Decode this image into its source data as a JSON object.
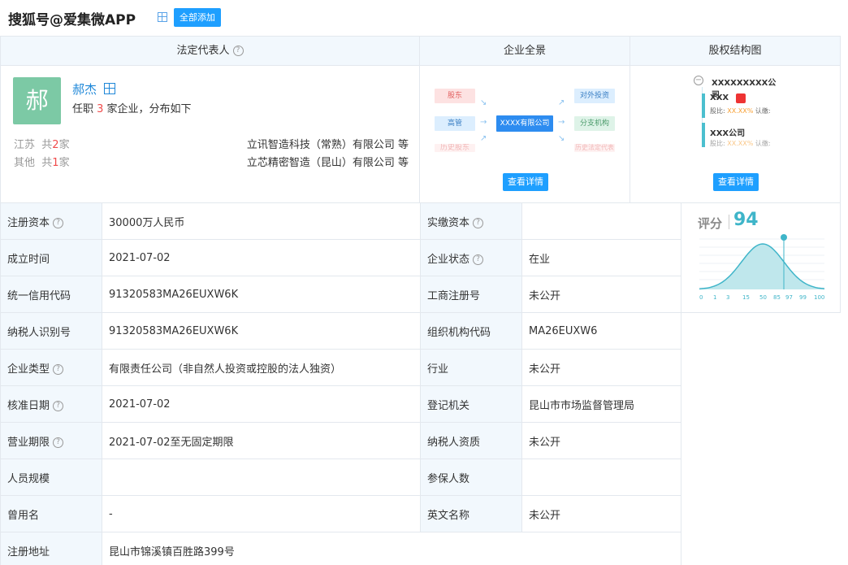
{
  "topbar": {
    "watermark": "搜狐号@爱集微APP",
    "add_all_button": "全部添加"
  },
  "panels": {
    "legal": {
      "title": "法定代表人",
      "person": {
        "avatar_char": "郝",
        "name": "郝杰",
        "desc_prefix": "任职 ",
        "count": "3",
        "desc_suffix": " 家企业，分布如下"
      },
      "regions": [
        {
          "region": "江苏",
          "prefix": "共",
          "count": "2",
          "suffix": "家",
          "company": "立讯智造科技（常熟）有限公司 等"
        },
        {
          "region": "其他",
          "prefix": "共",
          "count": "1",
          "suffix": "家",
          "company": "立芯精密智造（昆山）有限公司 等"
        }
      ]
    },
    "overview": {
      "title": "企业全景",
      "boxes": {
        "shareholder": "股东",
        "executive": "高管",
        "history": "历史股东",
        "center": "XXXX有限公司",
        "investment": "对外投资",
        "branch": "分支机构",
        "history_legal": "历史法定代表人"
      },
      "detail_button": "查看详情"
    },
    "equity": {
      "title": "股权结构图",
      "company": "XXXXXXXXX公司",
      "node1_name": "XXX",
      "node1_ratio_label": "股比:",
      "node1_ratio": "XX.XX%",
      "node1_sub": "认缴:",
      "node2_name": "XXX公司",
      "node2_ratio_label": "股比:",
      "node2_ratio": "XX.XX%",
      "node2_sub": "认缴:",
      "detail_button": "查看详情"
    }
  },
  "score": {
    "label": "评分",
    "value": "94",
    "axis_ticks": [
      "0",
      "1",
      "3",
      "15",
      "50",
      "85",
      "97",
      "99",
      "100"
    ],
    "accent": "#3fb5c9"
  },
  "info_rows": [
    {
      "l1": "注册资本",
      "h1": true,
      "v1": "30000万人民币",
      "l2": "实缴资本",
      "h2": true,
      "v2": ""
    },
    {
      "l1": "成立时间",
      "h1": false,
      "v1": "2021-07-02",
      "l2": "企业状态",
      "h2": true,
      "v2": "在业"
    },
    {
      "l1": "统一信用代码",
      "h1": false,
      "v1": "91320583MA26EUXW6K",
      "l2": "工商注册号",
      "h2": false,
      "v2": "未公开"
    },
    {
      "l1": "纳税人识别号",
      "h1": false,
      "v1": "91320583MA26EUXW6K",
      "l2": "组织机构代码",
      "h2": false,
      "v2": "MA26EUXW6"
    },
    {
      "l1": "企业类型",
      "h1": true,
      "v1": "有限责任公司（非自然人投资或控股的法人独资）",
      "l2": "行业",
      "h2": false,
      "v2": "未公开"
    },
    {
      "l1": "核准日期",
      "h1": true,
      "v1": "2021-07-02",
      "l2": "登记机关",
      "h2": false,
      "v2": "昆山市市场监督管理局"
    },
    {
      "l1": "营业期限",
      "h1": true,
      "v1": "2021-07-02至无固定期限",
      "l2": "纳税人资质",
      "h2": false,
      "v2": "未公开"
    },
    {
      "l1": "人员规模",
      "h1": false,
      "v1": "",
      "l2": "参保人数",
      "h2": false,
      "v2": ""
    },
    {
      "l1": "曾用名",
      "h1": false,
      "v1": "-",
      "l2": "英文名称",
      "h2": false,
      "v2": "未公开"
    },
    {
      "l1": "注册地址",
      "h1": false,
      "v1": "昆山市锦溪镇百胜路399号",
      "l2": "",
      "h2": false,
      "v2": ""
    }
  ]
}
